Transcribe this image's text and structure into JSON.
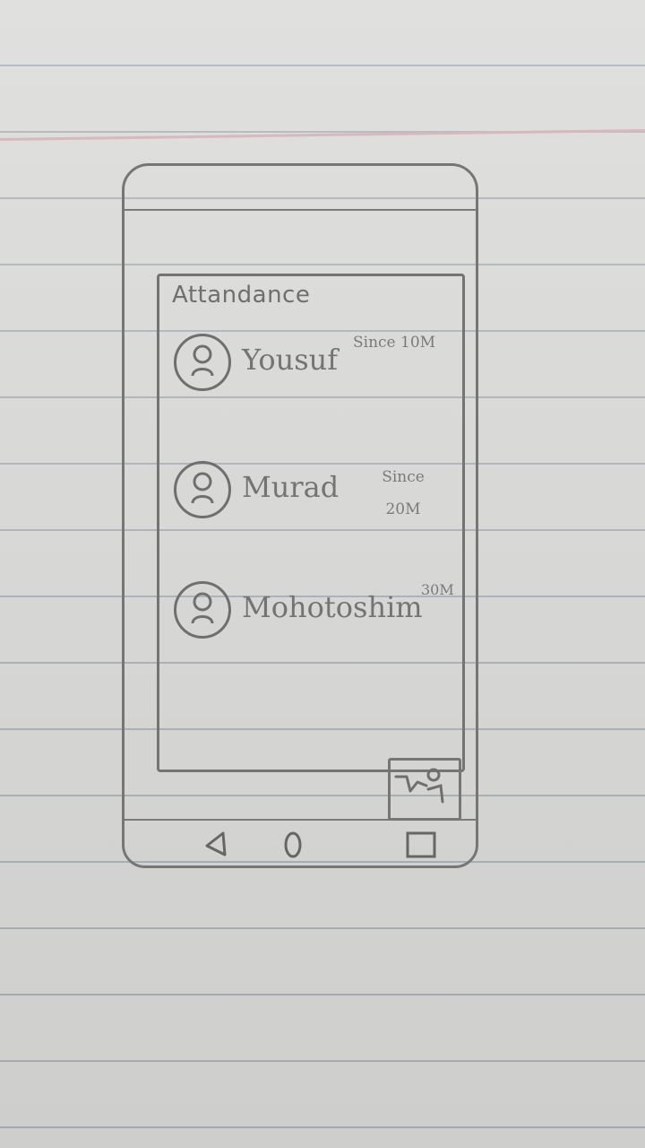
{
  "app": {
    "title": "Attandance"
  },
  "users": [
    {
      "name": "Yousuf",
      "time": "Since 10M",
      "avatar_icon": "person-avatar-icon"
    },
    {
      "name": "Murad",
      "time": "Since 20M",
      "avatar_icon": "person-avatar-icon"
    },
    {
      "name": "Mohotoshim",
      "time": "30M",
      "avatar_icon": "person-avatar-icon"
    }
  ],
  "fab": {
    "icon": "photo-icon"
  },
  "navigation": {
    "back_icon": "back-icon",
    "home_icon": "home-icon",
    "recent_icon": "recent-apps-icon"
  },
  "colors": {
    "pencil": "#747474",
    "paper": "#d9d9d7",
    "rule_line": "#a9b0b7"
  }
}
